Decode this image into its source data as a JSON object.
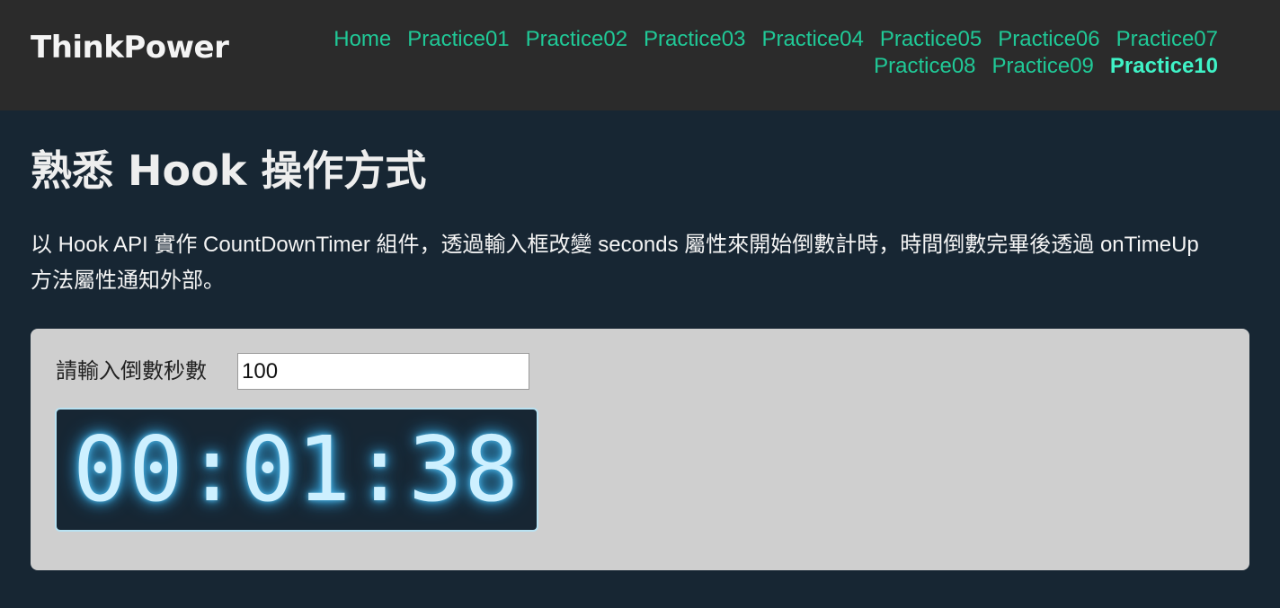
{
  "header": {
    "logo": "ThinkPower",
    "nav": [
      {
        "label": "Home",
        "active": false
      },
      {
        "label": "Practice01",
        "active": false
      },
      {
        "label": "Practice02",
        "active": false
      },
      {
        "label": "Practice03",
        "active": false
      },
      {
        "label": "Practice04",
        "active": false
      },
      {
        "label": "Practice05",
        "active": false
      },
      {
        "label": "Practice06",
        "active": false
      },
      {
        "label": "Practice07",
        "active": false
      },
      {
        "label": "Practice08",
        "active": false
      },
      {
        "label": "Practice09",
        "active": false
      },
      {
        "label": "Practice10",
        "active": true
      }
    ]
  },
  "page": {
    "title": "熟悉 Hook 操作方式",
    "description": "以 Hook API 實作 CountDownTimer 組件，透過輸入框改變 seconds 屬性來開始倒數計時，時間倒數完畢後透過 onTimeUp 方法屬性通知外部。"
  },
  "timer_form": {
    "label": "請輸入倒數秒數",
    "input_value": "100",
    "display": "00:01:38"
  },
  "colors": {
    "header_bg": "#2b2b2b",
    "page_bg": "#172633",
    "nav_link": "#20c997",
    "nav_active": "#3ff2c6",
    "card_bg": "#cfcfcf",
    "timer_text": "#cdf0ff",
    "timer_glow": "#4fb8e8"
  }
}
